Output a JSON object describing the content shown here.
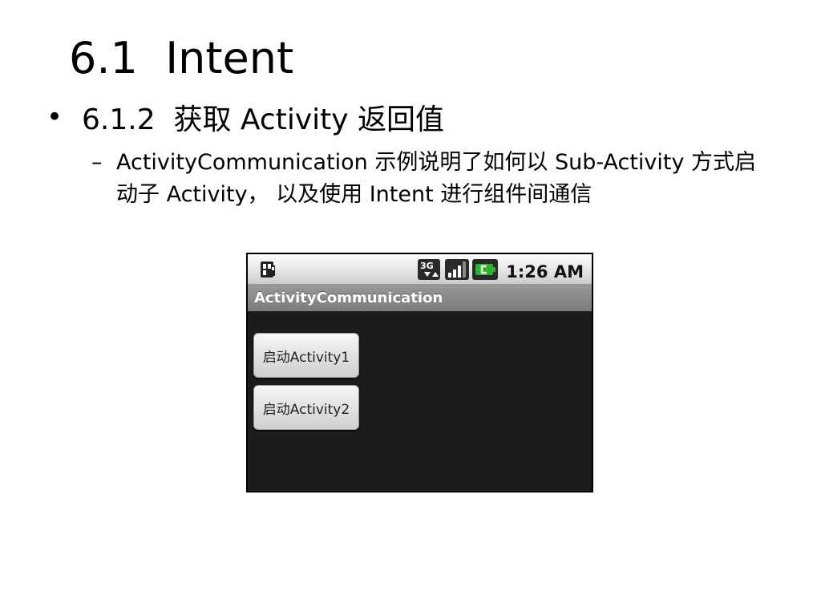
{
  "slide": {
    "title": "6.1  Intent",
    "bullet_l1": "6.1.2  获取 Activity 返回值",
    "bullet_l2_dash": "–",
    "bullet_l2": "ActivityCommunication 示例说明了如何以 Sub-Activity 方式启动子 Activity， 以及使用 Intent 进行组件间通信"
  },
  "phone": {
    "status_bar": {
      "time": "1:26 AM",
      "icons": [
        "sim-icon",
        "3g-data-icon",
        "signal-icon",
        "battery-icon"
      ]
    },
    "app_title": "ActivityCommunication",
    "buttons": [
      {
        "label": "启动Activity1"
      },
      {
        "label": "启动Activity2"
      }
    ]
  },
  "colors": {
    "screen_background": "#1c1c1c",
    "appbar_background": "#8a8a8a",
    "battery_accent": "#2bb52b"
  }
}
